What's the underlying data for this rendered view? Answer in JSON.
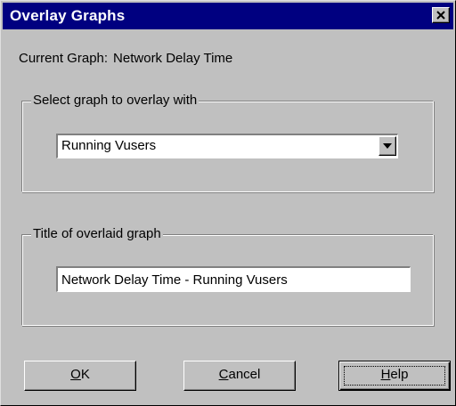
{
  "window": {
    "title": "Overlay Graphs",
    "close_icon": "close-icon"
  },
  "current_graph": {
    "label": "Current Graph:",
    "value": "Network Delay Time"
  },
  "select_group": {
    "legend": "Select graph to overlay with",
    "selected_value": "Running Vusers",
    "dropdown_icon": "chevron-down-icon"
  },
  "title_group": {
    "legend": "Title of overlaid graph",
    "value": "Network Delay Time - Running Vusers"
  },
  "buttons": {
    "ok": {
      "mnemonic": "O",
      "rest": "K"
    },
    "cancel": {
      "mnemonic": "C",
      "rest": "ancel"
    },
    "help": {
      "mnemonic": "H",
      "rest": "elp"
    }
  }
}
